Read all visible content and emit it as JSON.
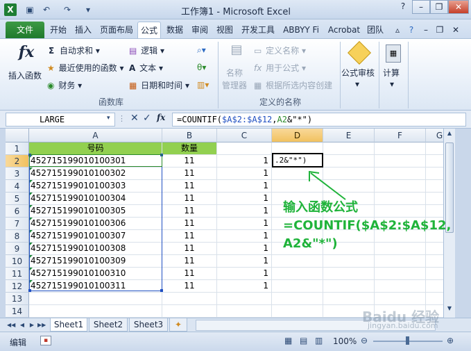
{
  "window": {
    "title": "工作簿1 - Microsoft Excel",
    "app_icon": "X",
    "controls": [
      "?",
      "–",
      "❐",
      "✕"
    ]
  },
  "ribbon_tabs": [
    "文件",
    "开始",
    "插入",
    "页面布局",
    "公式",
    "数据",
    "审阅",
    "视图",
    "开发工具",
    "ABBYY Fi",
    "Acrobat",
    "团队"
  ],
  "ribbon": {
    "insert_function": "插入函数",
    "autosum": "自动求和",
    "recent": "最近使用的函数",
    "financial": "财务",
    "logical": "逻辑",
    "text": "文本",
    "datetime": "日期和时间",
    "group_library": "函数库",
    "name_manager": [
      "名称",
      "管理器"
    ],
    "define_name": "定义名称",
    "use_in_formula": "用于公式",
    "create_from_selection": "根据所选内容创建",
    "group_names": "定义的名称",
    "formula_auditing": "公式审核",
    "calculation": "计算"
  },
  "formula_bar": {
    "name_box": "LARGE",
    "formula_prefix": "=COUNTIF(",
    "formula_ref1": "$A$2:$A$12",
    "formula_comma": ",",
    "formula_ref2": "A2",
    "formula_suffix": "&\"*\")",
    "cancel": "✕",
    "enter": "✓",
    "fx": "fx"
  },
  "grid": {
    "columns": [
      "A",
      "B",
      "C",
      "D",
      "E",
      "F",
      "G"
    ],
    "rows": [
      "1",
      "2",
      "3",
      "4",
      "5",
      "6",
      "7",
      "8",
      "9",
      "10",
      "11",
      "12",
      "13",
      "14"
    ],
    "header_a": "号码",
    "header_b": "数量",
    "ids": [
      "452715199010100301",
      "452715199010100302",
      "452715199010100303",
      "452715199010100304",
      "452715199010100305",
      "452715199010100306",
      "452715199010100307",
      "452715199010100308",
      "452715199010100309",
      "452715199010100310",
      "452715199010100311"
    ],
    "qty": [
      "11",
      "11",
      "11",
      "11",
      "11",
      "11",
      "11",
      "11",
      "11",
      "11",
      "11"
    ],
    "col_c": [
      "1",
      "1",
      "1",
      "1",
      "1",
      "1",
      "1",
      "1",
      "1",
      "1",
      "1"
    ],
    "editing_cell": ".2&\"*\")"
  },
  "sheets": [
    "Sheet1",
    "Sheet2",
    "Sheet3"
  ],
  "status": {
    "mode": "编辑",
    "zoom": "100%"
  },
  "annotation": {
    "line1": "输入函数公式",
    "line2": "=COUNTIF($A$2:$A$12,",
    "line3": "A2&\"*\")"
  },
  "watermark": {
    "brand": "Baidu 经验",
    "url": "jingyan.baidu.com"
  }
}
